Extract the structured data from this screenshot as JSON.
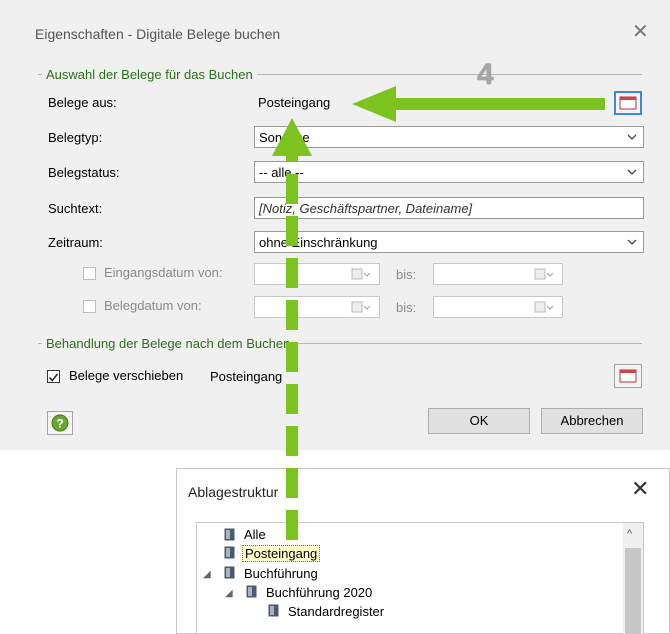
{
  "dialog": {
    "title": "Eigenschaften - Digitale Belege buchen",
    "group1_title": "Auswahl der Belege für das Buchen",
    "fields": {
      "belege_aus": {
        "label": "Belege aus:",
        "value": "Posteingang"
      },
      "belegtyp": {
        "label": "Belegtyp:",
        "value": "Sonstige"
      },
      "belegstatus": {
        "label": "Belegstatus:",
        "value": "-- alle --"
      },
      "suchtext": {
        "label": "Suchtext:",
        "placeholder": "[Notiz, Geschäftspartner, Dateiname]"
      },
      "zeitraum": {
        "label": "Zeitraum:",
        "value": "ohne Einschränkung"
      },
      "eingangsdatum": {
        "label": "Eingangsdatum von:",
        "bis": "bis:"
      },
      "belegdatum": {
        "label": "Belegdatum von:",
        "bis": "bis:"
      }
    },
    "group2_title": "Behandlung der Belege nach dem Buchen",
    "verschieben": {
      "label": "Belege verschieben",
      "value": "Posteingang",
      "checked": true
    },
    "buttons": {
      "ok": "OK",
      "cancel": "Abbrechen"
    }
  },
  "ablage": {
    "title": "Ablagestruktur",
    "tree": [
      {
        "label": "Alle",
        "level": 0
      },
      {
        "label": "Posteingang",
        "level": 0,
        "selected": true
      },
      {
        "label": "Buchführung",
        "level": 0,
        "expanded": true
      },
      {
        "label": "Buchführung 2020",
        "level": 1,
        "expanded": true
      },
      {
        "label": "Standardregister",
        "level": 2
      }
    ]
  },
  "annotation": {
    "step_number": "4",
    "arrow_color": "#7dc31f"
  }
}
